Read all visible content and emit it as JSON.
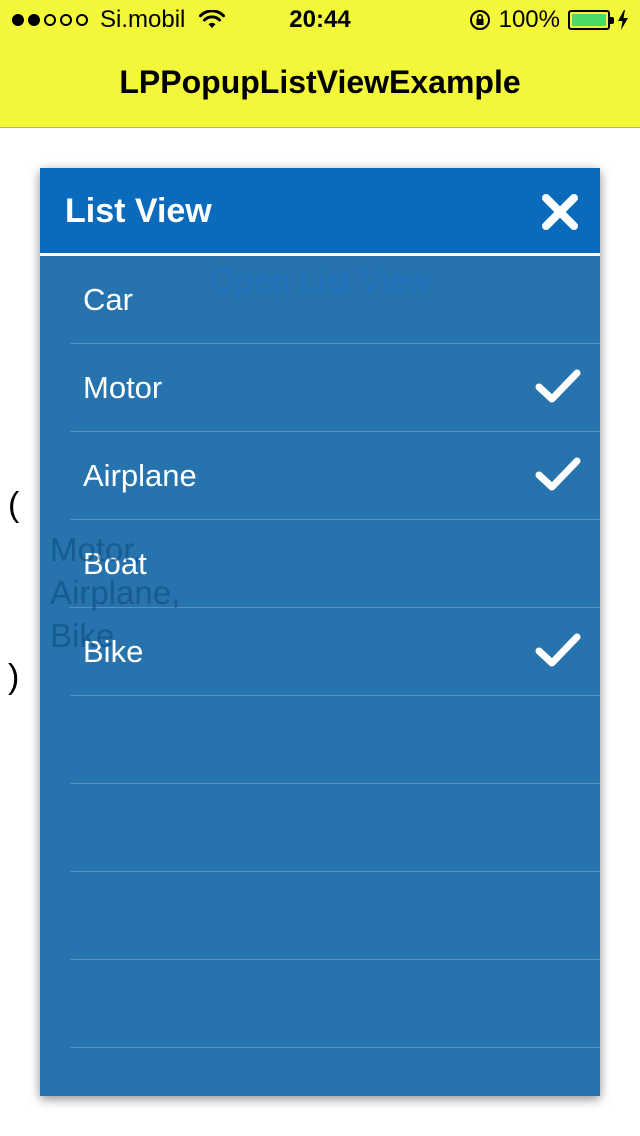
{
  "status_bar": {
    "signal_filled": 2,
    "signal_total": 5,
    "carrier": "Si.mobil",
    "time": "20:44",
    "battery_percent": "100%",
    "battery_level": 1.0
  },
  "nav": {
    "title": "LPPopupListViewExample"
  },
  "background": {
    "open_link": "Open List View",
    "paren_open": "(",
    "paren_close": ")",
    "selected_items": [
      "Motor,",
      "Airplane,",
      "Bike"
    ]
  },
  "popup": {
    "title": "List View",
    "close_icon": "close-icon",
    "items": [
      {
        "label": "Car",
        "checked": false
      },
      {
        "label": "Motor",
        "checked": true
      },
      {
        "label": "Airplane",
        "checked": true
      },
      {
        "label": "Boat",
        "checked": false
      },
      {
        "label": "Bike",
        "checked": true
      },
      {
        "label": "",
        "checked": false
      },
      {
        "label": "",
        "checked": false
      },
      {
        "label": "",
        "checked": false
      },
      {
        "label": "",
        "checked": false
      }
    ]
  },
  "colors": {
    "nav_bar": "#f2f73a",
    "popup_header": "#0a6bbd",
    "popup_body": "#2773ae",
    "link": "#1a74d0",
    "battery_fill": "#4cd964"
  }
}
